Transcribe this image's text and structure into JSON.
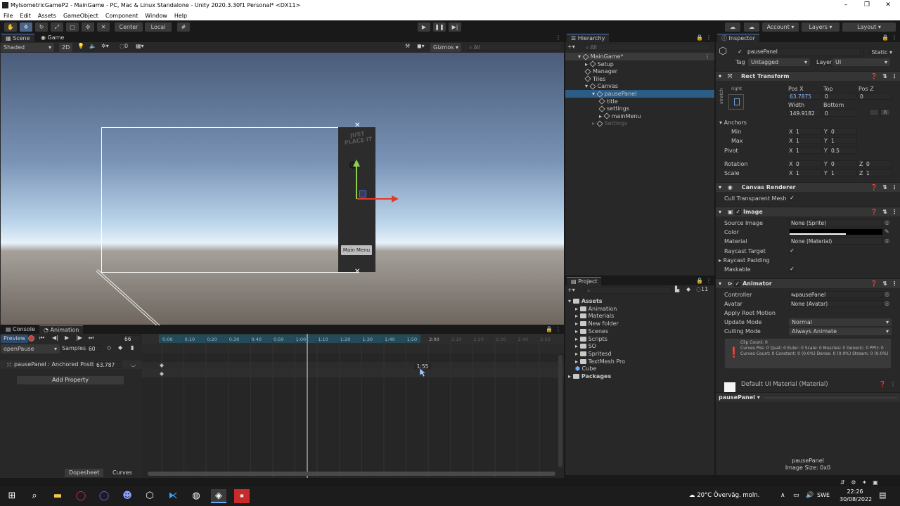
{
  "window": {
    "title": "MyIsometricGameP2 - MainGame - PC, Mac & Linux Standalone - Unity 2020.3.30f1 Personal* <DX11>"
  },
  "menu": [
    "File",
    "Edit",
    "Assets",
    "GameObject",
    "Component",
    "Window",
    "Help"
  ],
  "toolbar": {
    "pivot": "Center",
    "space": "Local",
    "account": "Account",
    "layers": "Layers",
    "layout": "Layout"
  },
  "scene": {
    "tab_scene": "Scene",
    "tab_game": "Game",
    "shading": "Shaded",
    "mode_2d": "2D",
    "fx_count": "0",
    "gizmos": "Gizmos",
    "search_placeholder": "All",
    "panel_text": "JUST PLACE IT",
    "button_text": "Main Menu"
  },
  "hierarchy": {
    "tab": "Hierarchy",
    "search_placeholder": "All",
    "items": [
      {
        "label": "MainGame*",
        "depth": 0,
        "type": "scene"
      },
      {
        "label": "Setup",
        "depth": 1
      },
      {
        "label": "Manager",
        "depth": 1
      },
      {
        "label": "Tiles",
        "depth": 1
      },
      {
        "label": "Canvas",
        "depth": 1
      },
      {
        "label": "pausePanel",
        "depth": 2
      },
      {
        "label": "title",
        "depth": 3
      },
      {
        "label": "settings",
        "depth": 3
      },
      {
        "label": "mainMenu",
        "depth": 3
      },
      {
        "label": "Settings",
        "depth": 2
      }
    ]
  },
  "project": {
    "tab": "Project",
    "count": "11",
    "items": [
      {
        "label": "Assets",
        "depth": 0,
        "kind": "folder-open"
      },
      {
        "label": "Animation",
        "depth": 1,
        "kind": "folder"
      },
      {
        "label": "Materials",
        "depth": 1,
        "kind": "folder"
      },
      {
        "label": "New folder",
        "depth": 1,
        "kind": "folder"
      },
      {
        "label": "Scenes",
        "depth": 1,
        "kind": "folder"
      },
      {
        "label": "Scripts",
        "depth": 1,
        "kind": "folder"
      },
      {
        "label": "SO",
        "depth": 1,
        "kind": "folder"
      },
      {
        "label": "Spritesd",
        "depth": 1,
        "kind": "folder"
      },
      {
        "label": "TextMesh Pro",
        "depth": 1,
        "kind": "folder"
      },
      {
        "label": "Cube",
        "depth": 1,
        "kind": "prefab"
      },
      {
        "label": "Packages",
        "depth": 0,
        "kind": "folder"
      }
    ]
  },
  "animation": {
    "tab_console": "Console",
    "tab_animation": "Animation",
    "preview": "Preview",
    "frame": "66",
    "clip": "openPause",
    "samples_label": "Samples",
    "samples": "60",
    "property": "pausePanel : Anchored Positic",
    "property_value": "63.787",
    "add_property": "Add Property",
    "tab_dopesheet": "Dopesheet",
    "tab_curves": "Curves",
    "cursor_label": "1:55",
    "ticks": [
      "0:00",
      "0:10",
      "0:20",
      "0:30",
      "0:40",
      "0:50",
      "1:00",
      "1:10",
      "1:20",
      "1:30",
      "1:40",
      "1:50",
      "2:00",
      "2:10",
      "2:20",
      "2:30",
      "2:40",
      "2:50"
    ]
  },
  "inspector": {
    "tab": "Inspector",
    "object_name": "pausePanel",
    "static": "Static",
    "tag_label": "Tag",
    "tag": "Untagged",
    "layer_label": "Layer",
    "layer": "UI",
    "rect_transform": {
      "title": "Rect Transform",
      "anchor_h": "right",
      "anchor_v": "stretch",
      "posx_label": "Pos X",
      "posx": "63.7875",
      "top_label": "Top",
      "top": "0",
      "posz_label": "Pos Z",
      "posz": "0",
      "width_label": "Width",
      "width": "149.9182",
      "bottom_label": "Bottom",
      "bottom": "0",
      "anchors": "Anchors",
      "min": "Min",
      "max": "Max",
      "min_x": "1",
      "min_y": "0",
      "max_x": "1",
      "max_y": "1",
      "pivot": "Pivot",
      "pivot_x": "1",
      "pivot_y": "0.5",
      "rotation": "Rotation",
      "rot_x": "0",
      "rot_y": "0",
      "rot_z": "0",
      "scale": "Scale",
      "scale_x": "1",
      "scale_y": "1",
      "scale_z": "1"
    },
    "canvas_renderer": {
      "title": "Canvas Renderer",
      "cull": "Cull Transparent Mesh"
    },
    "image": {
      "title": "Image",
      "source_label": "Source Image",
      "source": "None (Sprite)",
      "color_label": "Color",
      "material_label": "Material",
      "material": "None (Material)",
      "raycast_target": "Raycast Target",
      "raycast_padding": "Raycast Padding",
      "maskable": "Maskable"
    },
    "animator": {
      "title": "Animator",
      "controller_label": "Controller",
      "controller": "pausePanel",
      "avatar_label": "Avatar",
      "avatar": "None (Avatar)",
      "apply_root": "Apply Root Motion",
      "update_label": "Update Mode",
      "update": "Normal",
      "culling_label": "Culling Mode",
      "culling": "Always Animate",
      "info": [
        "Clip Count: 0",
        "Curves Pos: 0 Quat: 0 Euler: 0 Scale: 0 Muscles: 0 Generic: 0 PPtr: 0",
        "Curves Count: 0 Constant: 0 (0.0%) Dense: 0 (0.0%) Stream: 0 (0.0%)"
      ]
    },
    "material": "Default UI Material (Material)",
    "preview_name": "pausePanel",
    "preview_caption_name": "pausePanel",
    "preview_caption_size": "Image Size: 0x0"
  },
  "taskbar": {
    "weather": "20°C  Överväg. moln.",
    "lang": "SWE",
    "time": "22:26",
    "date": "30/08/2022"
  },
  "colors": {
    "accent": "#4d78cc",
    "selection": "#2c5d87"
  }
}
